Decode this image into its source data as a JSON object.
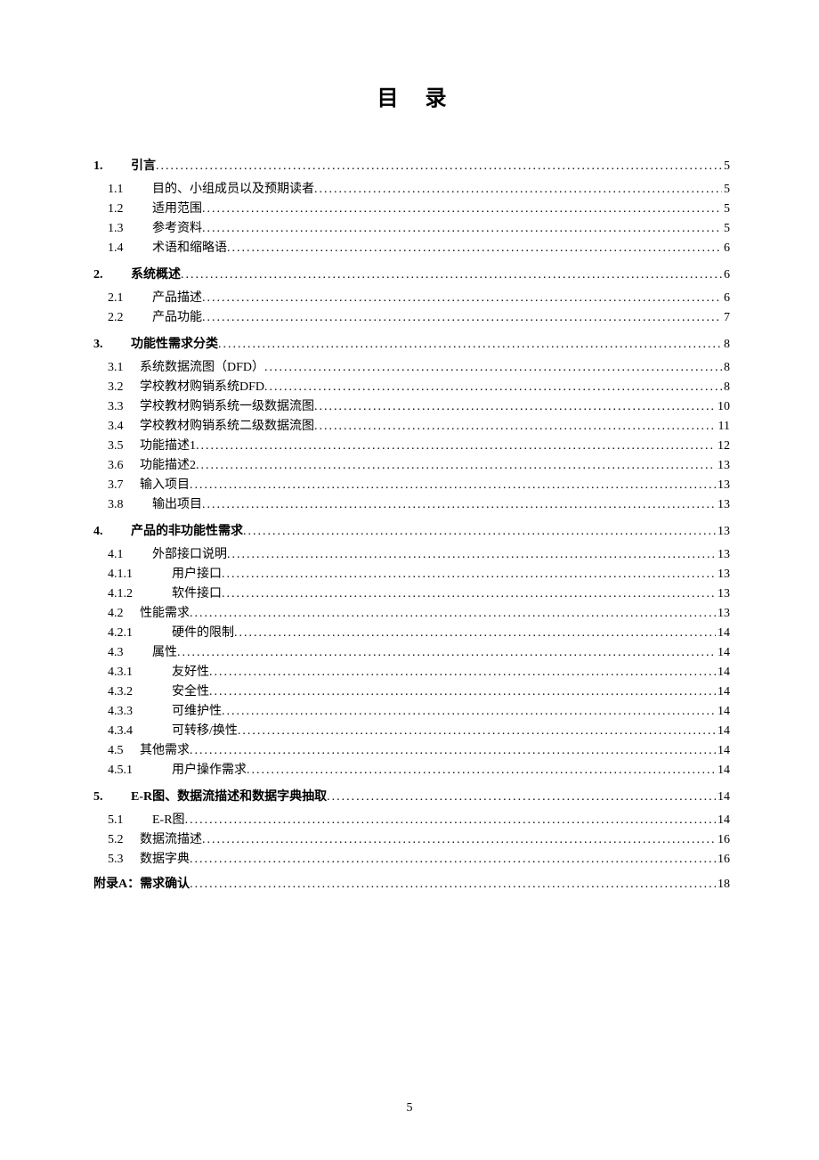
{
  "title": "目录",
  "page_number": "5",
  "toc": [
    {
      "level": 1,
      "num": "1.",
      "text": "引言",
      "page": "5",
      "first": true
    },
    {
      "level": 2,
      "num": "1.1",
      "text": "目的、小组成员以及预期读者",
      "page": "5",
      "wide": true
    },
    {
      "level": 2,
      "num": "1.2",
      "text": "适用范围",
      "page": "5",
      "wide": true
    },
    {
      "level": 2,
      "num": "1.3",
      "text": "参考资料",
      "page": "5",
      "wide": true
    },
    {
      "level": 2,
      "num": "1.4",
      "text": "术语和缩略语",
      "page": "6",
      "wide": true
    },
    {
      "level": 1,
      "num": "2.",
      "text": "系统概述",
      "page": "6"
    },
    {
      "level": 2,
      "num": "2.1",
      "text": "产品描述",
      "page": "6",
      "wide": true
    },
    {
      "level": 2,
      "num": "2.2",
      "text": "产品功能",
      "page": "7",
      "wide": true
    },
    {
      "level": 1,
      "num": "3.",
      "text": "功能性需求分类",
      "page": "8"
    },
    {
      "level": 2,
      "num": "3.1",
      "text": "系统数据流图（DFD）",
      "page": "8"
    },
    {
      "level": 2,
      "num": "3.2",
      "text": "学校教材购销系统DFD",
      "page": "8"
    },
    {
      "level": 2,
      "num": "3.3",
      "text": "学校教材购销系统一级数据流图",
      "page": "10"
    },
    {
      "level": 2,
      "num": "3.4",
      "text": "学校教材购销系统二级数据流图",
      "page": "11"
    },
    {
      "level": 2,
      "num": "3.5",
      "text": "功能描述1",
      "page": "12"
    },
    {
      "level": 2,
      "num": "3.6",
      "text": "功能描述2",
      "page": "13"
    },
    {
      "level": 2,
      "num": "3.7",
      "text": "输入项目",
      "page": "13"
    },
    {
      "level": 2,
      "num": "3.8",
      "text": "输出项目",
      "page": "13",
      "wide": true
    },
    {
      "level": 1,
      "num": "4.",
      "text": "产品的非功能性需求",
      "page": "13"
    },
    {
      "level": 2,
      "num": "4.1",
      "text": "外部接口说明",
      "page": "13",
      "wide": true
    },
    {
      "level": 3,
      "num": "4.1.1",
      "text": "用户接口",
      "page": "13"
    },
    {
      "level": 3,
      "num": "4.1.2",
      "text": "软件接口",
      "page": "13"
    },
    {
      "level": 2,
      "num": "4.2",
      "text": "性能需求",
      "page": "13"
    },
    {
      "level": 3,
      "num": "4.2.1",
      "text": "硬件的限制",
      "page": "14"
    },
    {
      "level": 2,
      "num": "4.3",
      "text": "属性",
      "page": "14",
      "wide": true
    },
    {
      "level": 3,
      "num": "4.3.1",
      "text": "友好性",
      "page": "14"
    },
    {
      "level": 3,
      "num": "4.3.2",
      "text": "安全性",
      "page": "14"
    },
    {
      "level": 3,
      "num": "4.3.3",
      "text": "可维护性",
      "page": "14"
    },
    {
      "level": 3,
      "num": "4.3.4",
      "text": "可转移/换性",
      "page": "14"
    },
    {
      "level": 2,
      "num": "4.5",
      "text": "其他需求",
      "page": "14"
    },
    {
      "level": 3,
      "num": "4.5.1",
      "text": "用户操作需求",
      "page": "14"
    },
    {
      "level": 1,
      "num": "5.",
      "text": "E-R图、数据流描述和数据字典抽取",
      "page": "14"
    },
    {
      "level": 2,
      "num": "5.1",
      "text": "E-R图",
      "page": "14",
      "wide": true
    },
    {
      "level": 2,
      "num": "5.2",
      "text": "数据流描述",
      "page": "16"
    },
    {
      "level": 2,
      "num": "5.3",
      "text": "数据字典",
      "page": "16"
    },
    {
      "level": "appendix",
      "num": "",
      "text": "附录A：需求确认",
      "page": "18"
    }
  ]
}
